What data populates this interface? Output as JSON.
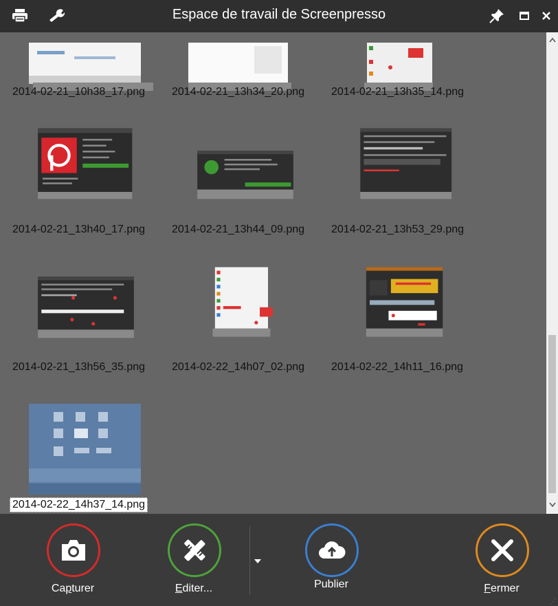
{
  "window": {
    "title": "Espace de travail de Screenpresso",
    "colors": {
      "background": "#666666",
      "titlebar": "#2f2f2f",
      "toolbar": "#3a3a3a"
    }
  },
  "thumbnails": [
    {
      "filename": "2014-02-21_10h38_17.png",
      "selected": false
    },
    {
      "filename": "2014-02-21_13h34_20.png",
      "selected": false
    },
    {
      "filename": "2014-02-21_13h35_14.png",
      "selected": false
    },
    {
      "filename": "2014-02-21_13h40_17.png",
      "selected": false
    },
    {
      "filename": "2014-02-21_13h44_09.png",
      "selected": false
    },
    {
      "filename": "2014-02-21_13h53_29.png",
      "selected": false
    },
    {
      "filename": "2014-02-21_13h56_35.png",
      "selected": false
    },
    {
      "filename": "2014-02-22_14h07_02.png",
      "selected": false
    },
    {
      "filename": "2014-02-22_14h11_16.png",
      "selected": false
    },
    {
      "filename": "2014-02-22_14h37_14.png",
      "selected": true
    }
  ],
  "toolbar": {
    "capture": {
      "label_pre": "Ca",
      "label_key": "p",
      "label_post": "turer",
      "icon": "camera-icon",
      "color": "#d62a2a"
    },
    "edit": {
      "label_key": "E",
      "label_post": "diter...",
      "icon": "edit-tools-icon",
      "color": "#4ea33a"
    },
    "publish": {
      "label": "Publier",
      "icon": "cloud-upload-icon",
      "color": "#3b7fd1"
    },
    "close": {
      "label_key": "F",
      "label_post": "ermer",
      "icon": "close-x-icon",
      "color": "#e08a1e"
    }
  }
}
